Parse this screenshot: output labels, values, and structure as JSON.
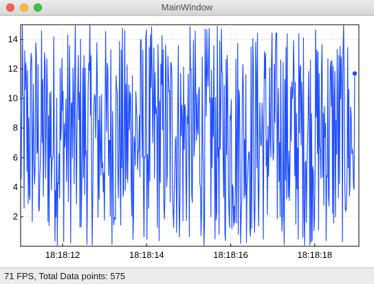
{
  "window": {
    "title": "MainWindow"
  },
  "status": {
    "text": "71 FPS, Total Data points: 575"
  },
  "colors": {
    "series": "#1f4fff",
    "grid": "#c8c8c8"
  },
  "chart_data": {
    "type": "line",
    "title": "",
    "xlabel": "",
    "ylabel": "",
    "ylim": [
      0,
      15
    ],
    "yticks": [
      2,
      4,
      6,
      8,
      10,
      12,
      14
    ],
    "ytick_labels": [
      "2",
      "4",
      "6",
      "8",
      "10",
      "12",
      "14"
    ],
    "xlim": [
      0,
      8.05
    ],
    "xticks": [
      1.0,
      3.0,
      5.0,
      7.0
    ],
    "xtick_labels": [
      "18:18:12",
      "18:18:14",
      "18:18:16",
      "18:18:18"
    ],
    "grid": true,
    "series": [
      {
        "point_count": 575,
        "last_value": 11.7,
        "values_note_random_0_15": true
      }
    ]
  }
}
